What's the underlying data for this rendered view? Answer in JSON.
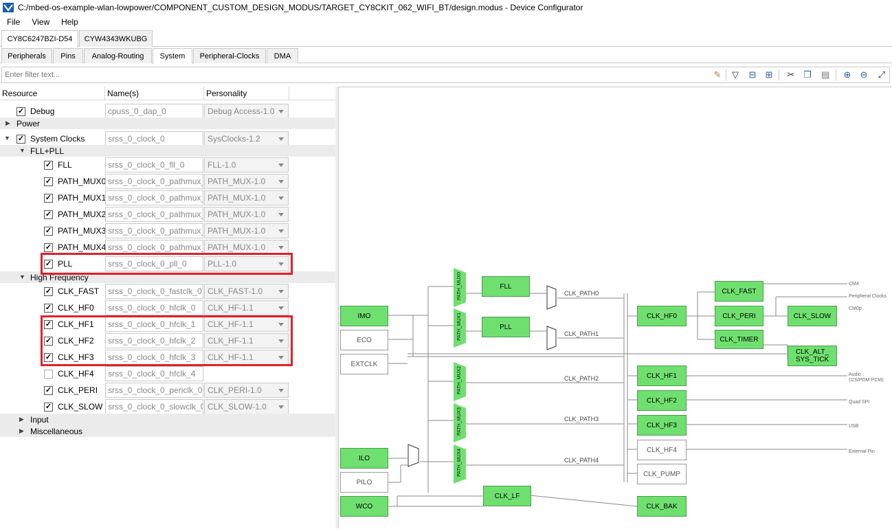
{
  "window": {
    "title": "C:/mbed-os-example-wlan-lowpower/COMPONENT_CUSTOM_DESIGN_MODUS/TARGET_CY8CKIT_062_WIFI_BT/design.modus - Device Configurator"
  },
  "menu": [
    "File",
    "View",
    "Help"
  ],
  "device_tabs": [
    "CY8C6247BZI-D54",
    "CYW4343WKUBG"
  ],
  "view_tabs": [
    "Peripherals",
    "Pins",
    "Analog-Routing",
    "System",
    "Peripheral-Clocks",
    "DMA"
  ],
  "active_view_tab": "System",
  "filter": {
    "placeholder": "Enter filter text..."
  },
  "toolbar_icons": [
    "clear-filter-icon",
    "filter-icon",
    "collapse-all-icon",
    "expand-all-icon",
    "cut-icon",
    "copy-icon",
    "paste-icon",
    "zoom-in-icon",
    "zoom-out-icon",
    "fit-icon"
  ],
  "tree": {
    "headers": [
      "Resource",
      "Name(s)",
      "Personality"
    ],
    "rows": [
      {
        "label": "Debug",
        "checked": true,
        "name": "cpuss_0_dap_0",
        "personality": "Debug Access-1.0",
        "group": false,
        "level": 1
      },
      {
        "label": "Power",
        "group": true,
        "level": 0,
        "expanded": false
      },
      {
        "label": "System Clocks",
        "checked": true,
        "name": "srss_0_clock_0",
        "personality": "SysClocks-1.2",
        "group": false,
        "level": 0,
        "expanded": true
      },
      {
        "label": "FLL+PLL",
        "group": true,
        "level": 1,
        "expanded": true
      },
      {
        "label": "FLL",
        "checked": true,
        "name": "srss_0_clock_0_fll_0",
        "personality": "FLL-1.0",
        "level": 2
      },
      {
        "label": "PATH_MUX0",
        "checked": true,
        "name": "srss_0_clock_0_pathmux_0",
        "personality": "PATH_MUX-1.0",
        "level": 2
      },
      {
        "label": "PATH_MUX1",
        "checked": true,
        "name": "srss_0_clock_0_pathmux_1",
        "personality": "PATH_MUX-1.0",
        "level": 2
      },
      {
        "label": "PATH_MUX2",
        "checked": true,
        "name": "srss_0_clock_0_pathmux_2",
        "personality": "PATH_MUX-1.0",
        "level": 2
      },
      {
        "label": "PATH_MUX3",
        "checked": true,
        "name": "srss_0_clock_0_pathmux_3",
        "personality": "PATH_MUX-1.0",
        "level": 2
      },
      {
        "label": "PATH_MUX4",
        "checked": true,
        "name": "srss_0_clock_0_pathmux_4",
        "personality": "PATH_MUX-1.0",
        "level": 2
      },
      {
        "label": "PLL",
        "checked": true,
        "name": "srss_0_clock_0_pll_0",
        "personality": "PLL-1.0",
        "level": 2
      },
      {
        "label": "High Frequency",
        "group": true,
        "level": 1,
        "expanded": true
      },
      {
        "label": "CLK_FAST",
        "checked": true,
        "name": "srss_0_clock_0_fastclk_0",
        "personality": "CLK_FAST-1.0",
        "level": 2
      },
      {
        "label": "CLK_HF0",
        "checked": true,
        "name": "srss_0_clock_0_hfclk_0",
        "personality": "CLK_HF-1.1",
        "level": 2
      },
      {
        "label": "CLK_HF1",
        "checked": true,
        "name": "srss_0_clock_0_hfclk_1",
        "personality": "CLK_HF-1.1",
        "level": 2
      },
      {
        "label": "CLK_HF2",
        "checked": true,
        "name": "srss_0_clock_0_hfclk_2",
        "personality": "CLK_HF-1.1",
        "level": 2
      },
      {
        "label": "CLK_HF3",
        "checked": true,
        "name": "srss_0_clock_0_hfclk_3",
        "personality": "CLK_HF-1.1",
        "level": 2
      },
      {
        "label": "CLK_HF4",
        "checked": false,
        "name": "srss_0_clock_0_hfclk_4",
        "personality": "",
        "level": 2
      },
      {
        "label": "CLK_PERI",
        "checked": true,
        "name": "srss_0_clock_0_periclk_0",
        "personality": "CLK_PERI-1.0",
        "level": 2
      },
      {
        "label": "CLK_SLOW",
        "checked": true,
        "name": "srss_0_clock_0_slowclk_0",
        "personality": "CLK_SLOW-1.0",
        "level": 2
      },
      {
        "label": "Input",
        "group": true,
        "level": 1,
        "expanded": false
      },
      {
        "label": "Miscellaneous",
        "group": true,
        "level": 1,
        "expanded": false
      }
    ]
  },
  "diagram": {
    "sources": [
      "IMO",
      "ECO",
      "EXTCLK",
      "ILO",
      "PILO",
      "WCO"
    ],
    "muxes": [
      "PATH_MUX0",
      "PATH_MUX1",
      "PATH_MUX2",
      "PATH_MUX3",
      "PATH_MUX4"
    ],
    "blocks": [
      "FLL",
      "PLL",
      "CLK_LF",
      "CLK_HF0",
      "CLK_HF1",
      "CLK_HF2",
      "CLK_HF3",
      "CLK_HF4",
      "CLK_PUMP",
      "CLK_BAK",
      "CLK_FAST",
      "CLK_PERI",
      "CLK_SLOW",
      "CLK_TIMER",
      "CLK_ALT_\nSYS_TICK"
    ],
    "paths": [
      "CLK_PATH0",
      "CLK_PATH1",
      "CLK_PATH2",
      "CLK_PATH3",
      "CLK_PATH4"
    ],
    "outputs": [
      "CM4",
      "Peripheral Clocks",
      "CM0p",
      "Audio\n(I2S/PDM-PCM)",
      "Quad SPI",
      "USB",
      "External Pin"
    ]
  }
}
